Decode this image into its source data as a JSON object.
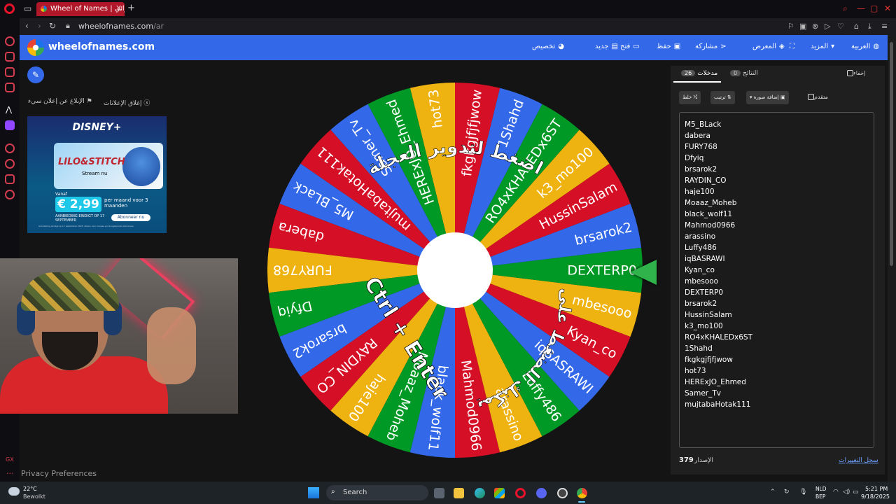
{
  "browser": {
    "tab_title": "Wheel of Names | عشوائي",
    "url_host": "wheelofnames.com",
    "url_path": "/ar"
  },
  "app": {
    "brand": "wheelofnames.com",
    "menu": {
      "customize": "تخصيص",
      "new": "جديد",
      "open": "فتح",
      "save": "حفظ",
      "share": "مشاركة",
      "gallery": "المعرض",
      "more": "المزيد",
      "language": "العربية"
    }
  },
  "ad": {
    "report": "الإبلاغ عن إعلان سيء",
    "close": "إغلاق الإعلانات",
    "brand": "DISNEY+",
    "title": "LILO&STITCH",
    "subtitle": "Stream nu",
    "vanaf": "Vanaf",
    "price": "€ 2,99",
    "per": "per maand voor 3 maanden",
    "offer": "AANBIEDING EINDIGT OP 17 SEPTEMBER",
    "cta": "Abonneer nu",
    "fine": "Aanbieding eindigt op 17 september 2025. Alleen voor nieuwe en terugkerende abonnees."
  },
  "privacy": "Privacy Preferences",
  "wheel": {
    "overlay_top": "اضغط لتدوير العجلة",
    "overlay_or": "أو يمكنك الضغط على زر",
    "overlay_keys": "Ctrl + Enter",
    "colors": [
      "#3369e8",
      "#d50f25",
      "#eeb211",
      "#009925"
    ]
  },
  "panel": {
    "entries_label": "مدخلات",
    "entries_count": "26",
    "results_label": "النتائج",
    "results_count": "0",
    "hide_label": "إخفاء",
    "shuffle_label": "خلط",
    "sort_label": "ترتيب",
    "add_image_label": "إضافة صورة",
    "advanced_label": "متقدم",
    "version_label": "الإصدار",
    "version_number": "379",
    "changelog_label": "سجل التغييرات"
  },
  "entries": [
    "M5_BLack",
    "dabera",
    "FURY768",
    "Dfyiq",
    "brsarok2",
    "RAYDIN_CO",
    "haje100",
    "Moaaz_Moheb",
    "black_wolf11",
    "Mahmod0966",
    "arassino",
    "Luffy486",
    "iqBASRAWI",
    "Kyan_co",
    "mbesooo",
    "DEXTERP0",
    "brsarok2",
    "HussinSalam",
    "k3_mo100",
    "RO4xKHALEDx6ST",
    "1Shahd",
    "fkgkgjfjfjwow",
    "hot73",
    "HERExJO_Ehmed",
    "Samer_Tv",
    "mujtabaHotak111"
  ],
  "taskbar": {
    "weather_temp": "22°C",
    "weather_desc": "Bewolkt",
    "search": "Search",
    "lang_line1": "NLD",
    "lang_line2": "BEP",
    "time": "5:21 PM",
    "date": "9/18/2025"
  }
}
